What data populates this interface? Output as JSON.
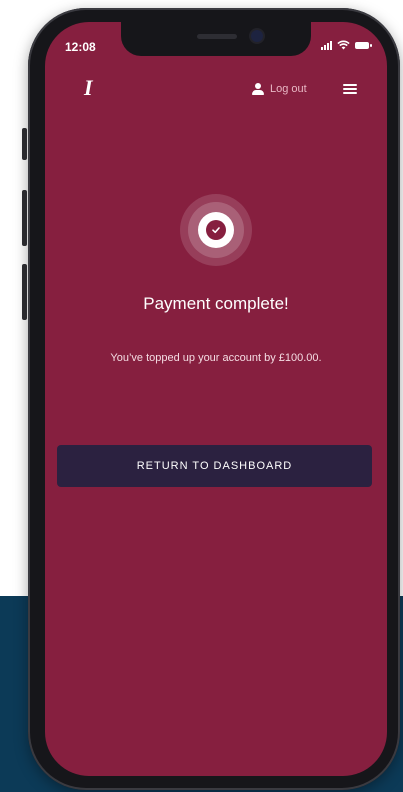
{
  "status_bar": {
    "time": "12:08"
  },
  "header": {
    "brand_mark": "I",
    "logout_label": "Log out"
  },
  "confirmation": {
    "title": "Payment complete!",
    "message": "You’ve topped up your account by £100.00."
  },
  "actions": {
    "return_label": "RETURN TO DASHBOARD"
  },
  "icons": {
    "status_check": "check-circle-icon",
    "user": "user-icon",
    "menu": "hamburger-menu-icon",
    "signal": "signal-icon",
    "wifi": "wifi-icon",
    "battery": "battery-icon"
  },
  "colors": {
    "screen_background": "#861f3f",
    "button_background": "#2b2140",
    "phone_frame": "#16161a",
    "page_accent": "#0c3a57"
  }
}
